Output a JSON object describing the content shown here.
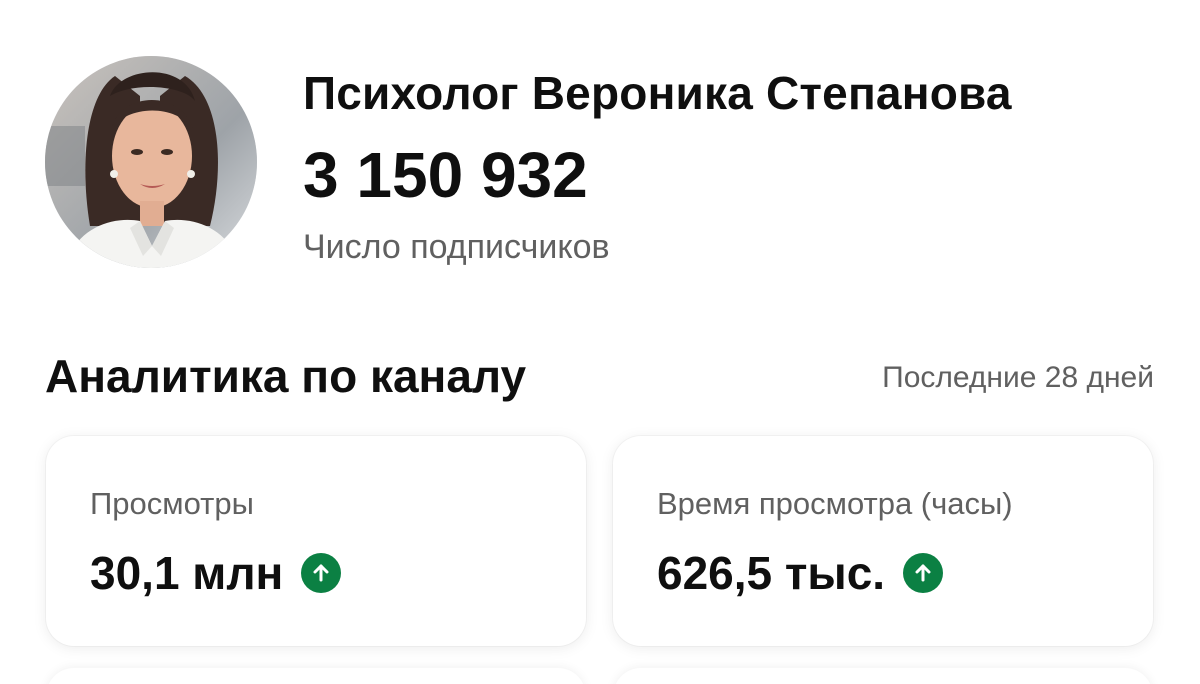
{
  "channel": {
    "name": "Психолог Вероника Степанова",
    "subscriber_count": "3 150 932",
    "subscriber_label": "Число подписчиков",
    "avatar_icon": "channel-avatar"
  },
  "analytics": {
    "title": "Аналитика по каналу",
    "period": "Последние 28 дней",
    "cards": [
      {
        "label": "Просмотры",
        "value": "30,1 млн",
        "trend": "up",
        "trend_icon": "arrow-up-icon"
      },
      {
        "label": "Время просмотра (часы)",
        "value": "626,5 тыс.",
        "trend": "up",
        "trend_icon": "arrow-up-icon"
      }
    ]
  },
  "colors": {
    "trend_up": "#0b8043",
    "secondary_text": "#606060",
    "primary_text": "#0f0f0f"
  }
}
